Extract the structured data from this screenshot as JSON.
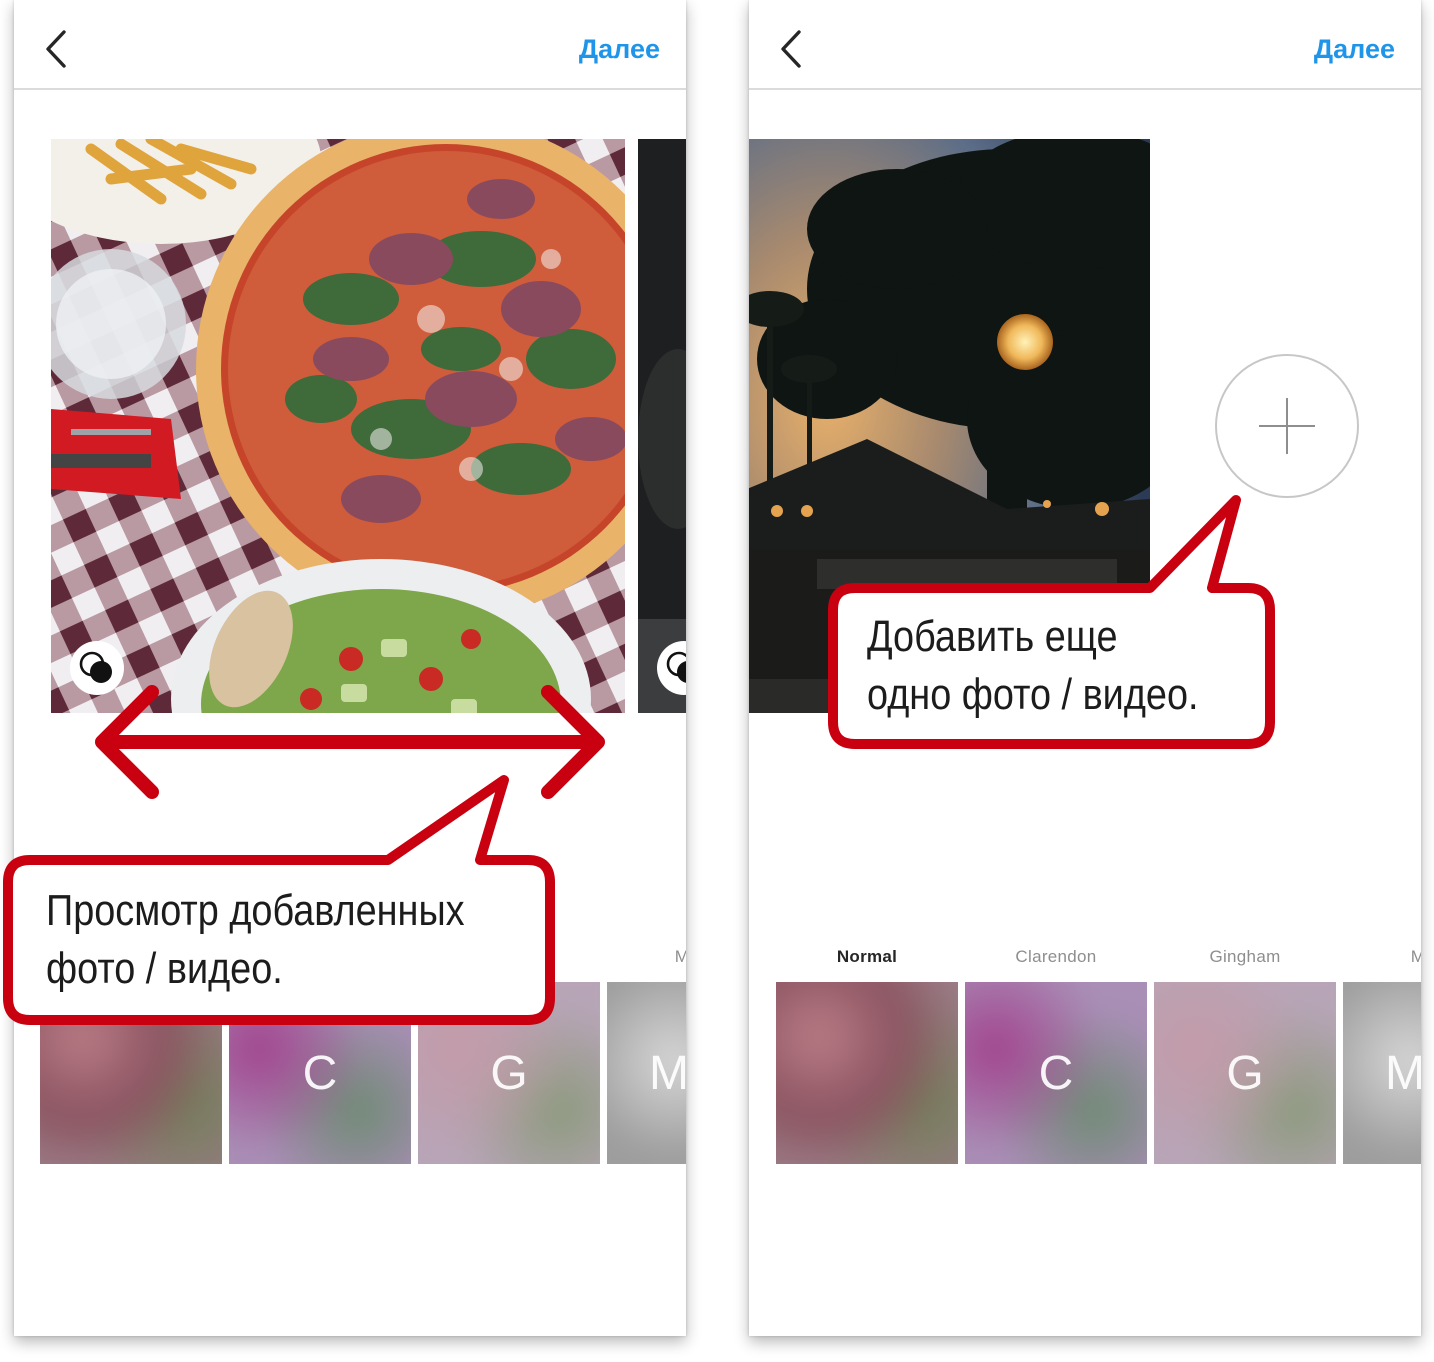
{
  "screens": [
    {
      "header": {
        "back_icon": "chevron-left-icon",
        "next_label": "Далее"
      },
      "badges": [
        "layers-icon",
        "layers-icon"
      ],
      "filters": [
        {
          "label": "",
          "letter": ""
        },
        {
          "label": "",
          "letter": "C"
        },
        {
          "label": "",
          "letter": "G"
        },
        {
          "label": "M",
          "letter": "M"
        }
      ]
    },
    {
      "header": {
        "back_icon": "chevron-left-icon",
        "next_label": "Далее"
      },
      "add_button_icon": "plus-icon",
      "filters": [
        {
          "label": "Normal",
          "letter": "",
          "active": true
        },
        {
          "label": "Clarendon",
          "letter": "C"
        },
        {
          "label": "Gingham",
          "letter": "G"
        },
        {
          "label": "M",
          "letter": "M"
        }
      ]
    }
  ],
  "annotations": {
    "left_callout": {
      "line1": "Просмотр добавленных",
      "line2": "фото / видео."
    },
    "right_callout": {
      "line1": "Добавить еще",
      "line2": "одно фото / видео."
    },
    "accent_color": "#c8000f"
  }
}
